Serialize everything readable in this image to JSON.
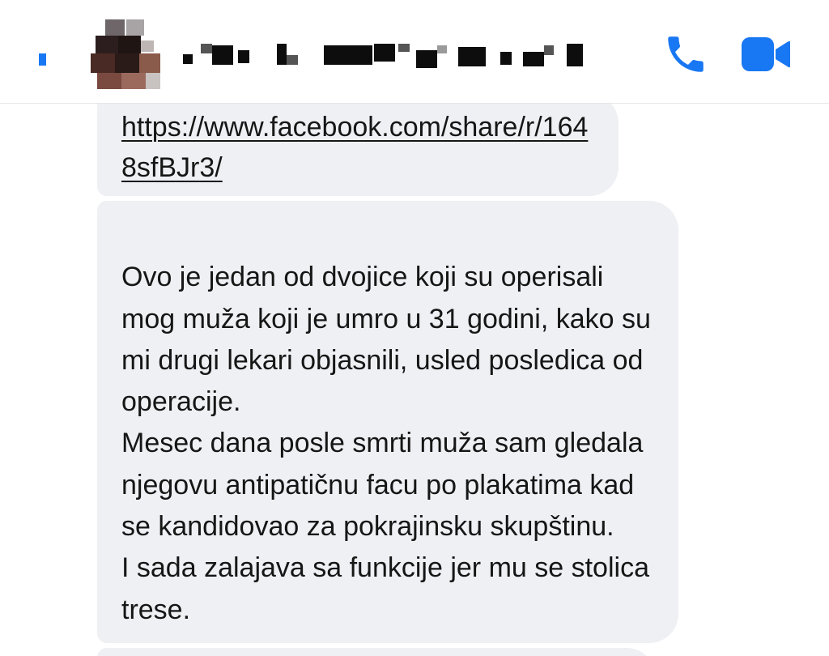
{
  "header": {
    "back_icon": "chevron-left-icon",
    "contact_name": "",
    "call_icon": "phone-icon",
    "video_icon": "video-camera-icon",
    "accent_color": "#1877f2"
  },
  "messages": [
    {
      "type": "link",
      "text": "https://www.facebook.com/share/r/1648sfBJr3/"
    },
    {
      "type": "text",
      "text": "Ovo je jedan od dvojice koji su operisali mog muža koji je umro u 31 godini, kako su mi drugi lekari objasnili,  usled posledica od operacije.\nMesec dana posle smrti muža sam gledala njegovu antipatičnu facu po plakatima kad se kandidovao za pokrajinsku skupštinu.\nI sada zalajava sa funkcije jer mu se stolica trese."
    }
  ],
  "colors": {
    "bubble_background": "#eff0f4",
    "text": "#161616",
    "header_divider": "#e6e6e9"
  }
}
